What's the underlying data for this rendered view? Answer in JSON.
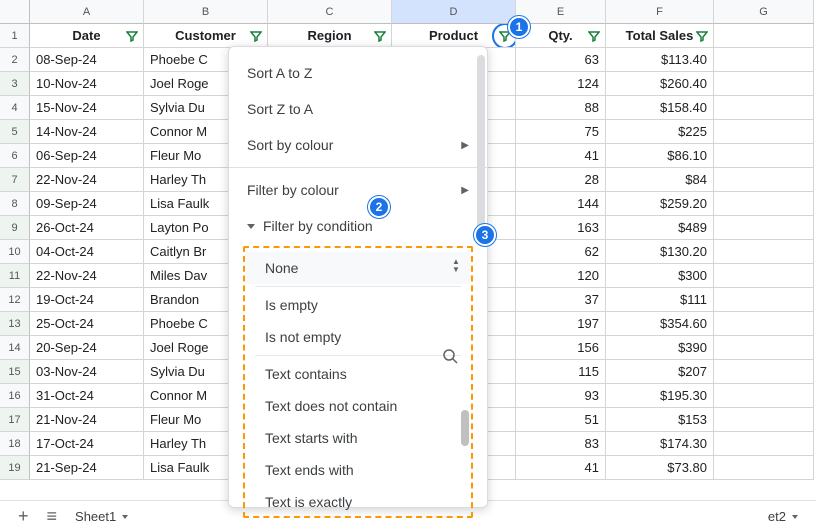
{
  "columns": [
    "A",
    "B",
    "C",
    "D",
    "E",
    "F",
    "G"
  ],
  "headers": {
    "date": "Date",
    "customer": "Customer",
    "region": "Region",
    "product": "Product",
    "qty": "Qty.",
    "sales": "Total Sales"
  },
  "rows": [
    {
      "n": 2,
      "date": "08-Sep-24",
      "cust": "Phoebe C",
      "qty": "63",
      "sales": "$113.40"
    },
    {
      "n": 3,
      "date": "10-Nov-24",
      "cust": "Joel Roge",
      "qty": "124",
      "sales": "$260.40"
    },
    {
      "n": 4,
      "date": "15-Nov-24",
      "cust": "Sylvia Du",
      "qty": "88",
      "sales": "$158.40"
    },
    {
      "n": 5,
      "date": "14-Nov-24",
      "cust": "Connor M",
      "qty": "75",
      "sales": "$225"
    },
    {
      "n": 6,
      "date": "06-Sep-24",
      "cust": "Fleur Mo",
      "qty": "41",
      "sales": "$86.10"
    },
    {
      "n": 7,
      "date": "22-Nov-24",
      "cust": "Harley Th",
      "qty": "28",
      "sales": "$84"
    },
    {
      "n": 8,
      "date": "09-Sep-24",
      "cust": "Lisa Faulk",
      "qty": "144",
      "sales": "$259.20"
    },
    {
      "n": 9,
      "date": "26-Oct-24",
      "cust": "Layton Po",
      "qty": "163",
      "sales": "$489"
    },
    {
      "n": 10,
      "date": "04-Oct-24",
      "cust": "Caitlyn Br",
      "qty": "62",
      "sales": "$130.20"
    },
    {
      "n": 11,
      "date": "22-Nov-24",
      "cust": "Miles Dav",
      "qty": "120",
      "sales": "$300"
    },
    {
      "n": 12,
      "date": "19-Oct-24",
      "cust": "Brandon",
      "qty": "37",
      "sales": "$111"
    },
    {
      "n": 13,
      "date": "25-Oct-24",
      "cust": "Phoebe C",
      "qty": "197",
      "sales": "$354.60"
    },
    {
      "n": 14,
      "date": "20-Sep-24",
      "cust": "Joel Roge",
      "qty": "156",
      "sales": "$390"
    },
    {
      "n": 15,
      "date": "03-Nov-24",
      "cust": "Sylvia Du",
      "qty": "115",
      "sales": "$207"
    },
    {
      "n": 16,
      "date": "31-Oct-24",
      "cust": "Connor M",
      "qty": "93",
      "sales": "$195.30"
    },
    {
      "n": 17,
      "date": "21-Nov-24",
      "cust": "Fleur Mo",
      "qty": "51",
      "sales": "$153"
    },
    {
      "n": 18,
      "date": "17-Oct-24",
      "cust": "Harley Th",
      "qty": "83",
      "sales": "$174.30"
    },
    {
      "n": 19,
      "date": "21-Sep-24",
      "cust": "Lisa Faulk",
      "qty": "41",
      "sales": "$73.80"
    }
  ],
  "dropdown": {
    "sort_az": "Sort A to Z",
    "sort_za": "Sort Z to A",
    "sort_colour": "Sort by colour",
    "filter_colour": "Filter by colour",
    "filter_condition": "Filter by condition",
    "conditions": {
      "none": "None",
      "is_empty": "Is empty",
      "is_not_empty": "Is not empty",
      "text_contains": "Text contains",
      "text_not_contain": "Text does not contain",
      "text_starts": "Text starts with",
      "text_ends": "Text ends with",
      "text_exactly": "Text is exactly"
    }
  },
  "badges": {
    "b1": "1",
    "b2": "2",
    "b3": "3"
  },
  "footer": {
    "sheet1": "Sheet1",
    "sheet2": "et2"
  }
}
